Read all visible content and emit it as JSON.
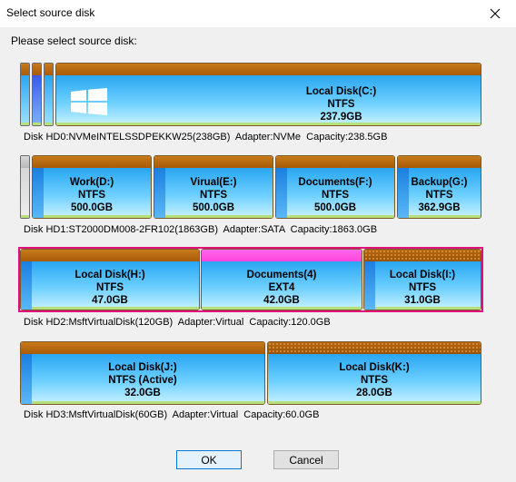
{
  "window": {
    "title": "Select source disk"
  },
  "prompt": "Please select source disk:",
  "disks": [
    {
      "info": "Disk HD0:NVMeINTELSSDPEKKW25(238GB)  Adapter:NVMe  Capacity:238.5GB",
      "partitions": [
        {
          "label": "Local Disk(C:)",
          "fs": "NTFS",
          "size": "237.9GB"
        }
      ]
    },
    {
      "info": "Disk HD1:ST2000DM008-2FR102(1863GB)  Adapter:SATA  Capacity:1863.0GB",
      "partitions": [
        {
          "label": "Work(D:)",
          "fs": "NTFS",
          "size": "500.0GB"
        },
        {
          "label": "Virual(E:)",
          "fs": "NTFS",
          "size": "500.0GB"
        },
        {
          "label": "Documents(F:)",
          "fs": "NTFS",
          "size": "500.0GB"
        },
        {
          "label": "Backup(G:)",
          "fs": "NTFS",
          "size": "362.9GB"
        }
      ]
    },
    {
      "info": "Disk HD2:MsftVirtualDisk(120GB)  Adapter:Virtual  Capacity:120.0GB",
      "partitions": [
        {
          "label": "Local Disk(H:)",
          "fs": "NTFS",
          "size": "47.0GB"
        },
        {
          "label": "Documents(4)",
          "fs": "EXT4",
          "size": "42.0GB"
        },
        {
          "label": "Local Disk(I:)",
          "fs": "NTFS",
          "size": "31.0GB"
        }
      ]
    },
    {
      "info": "Disk HD3:MsftVirtualDisk(60GB)  Adapter:Virtual  Capacity:60.0GB",
      "partitions": [
        {
          "label": "Local Disk(J:)",
          "fs": "NTFS (Active)",
          "size": "32.0GB"
        },
        {
          "label": "Local Disk(K:)",
          "fs": "NTFS",
          "size": "28.0GB"
        }
      ]
    }
  ],
  "selected_disk": "HD2",
  "buttons": {
    "ok": "OK",
    "cancel": "Cancel"
  },
  "colors": {
    "selection": "#e0127a",
    "partition_header": "#b5680f",
    "partition_fill": "#29a6f2"
  }
}
